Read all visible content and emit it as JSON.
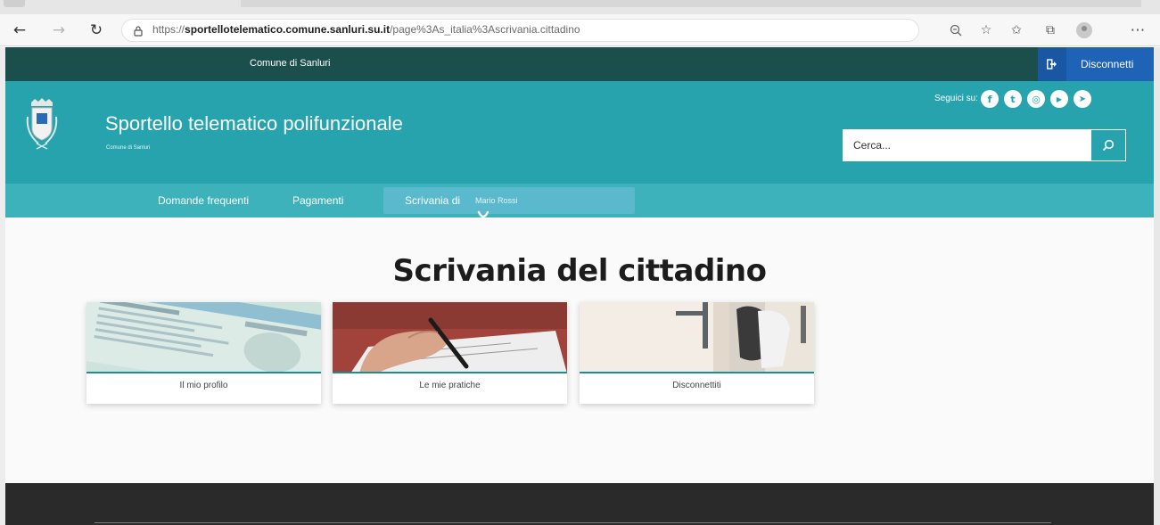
{
  "browser": {
    "url_prefix": "https://",
    "url_domain": "sportellotelematico.comune.sanluri.su.it",
    "url_path": "/page%3As_italia%3Ascrivania.cittadino",
    "icons": [
      "back-icon",
      "forward-icon",
      "refresh-icon",
      "lock-icon",
      "zoom-icon",
      "read-aloud-icon",
      "favorites-icon",
      "collections-icon",
      "profile-icon",
      "more-icon"
    ]
  },
  "topbar": {
    "entity": "Comune di Sanluri",
    "logout_label": "Disconnetti"
  },
  "header": {
    "title": "Sportello telematico polifunzionale",
    "subtitle": "Comune di Sanluri",
    "follow_label": "Seguici su:",
    "social": [
      {
        "name": "facebook-icon",
        "glyph": "f"
      },
      {
        "name": "twitter-icon",
        "glyph": "t"
      },
      {
        "name": "instagram-icon",
        "glyph": "◎"
      },
      {
        "name": "youtube-icon",
        "glyph": "▶"
      },
      {
        "name": "telegram-icon",
        "glyph": "➤"
      }
    ],
    "search_placeholder": "Cerca..."
  },
  "nav": {
    "items": [
      "Domande frequenti",
      "Pagamenti",
      "Scrivania di"
    ],
    "user_name": "Mario Rossi"
  },
  "main": {
    "title": "Scrivania del cittadino",
    "cards": [
      {
        "label": "Il mio profilo"
      },
      {
        "label": "Le mie pratiche"
      },
      {
        "label": "Disconnettiti"
      }
    ]
  },
  "colors": {
    "topbar": "#1b4f4c",
    "header": "#27a3ad",
    "nav": "#3db2ba",
    "logout": "#1f63b7",
    "footer": "#2a2a2a"
  }
}
